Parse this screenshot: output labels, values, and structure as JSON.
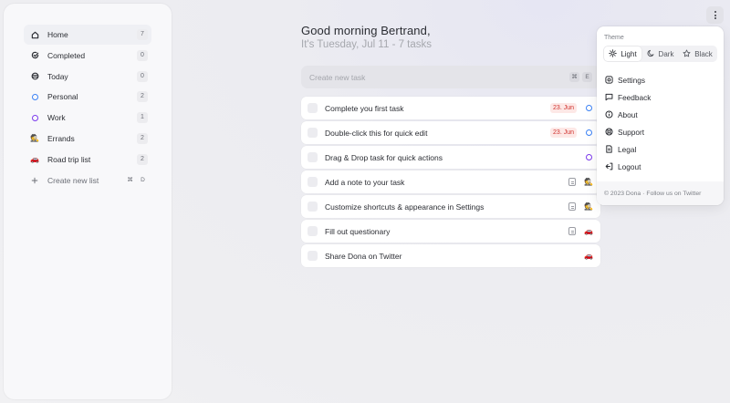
{
  "sidebar": {
    "items": [
      {
        "label": "Home",
        "count": "7",
        "icon": "home-icon"
      },
      {
        "label": "Completed",
        "count": "0",
        "icon": "check-circle-icon"
      },
      {
        "label": "Today",
        "count": "0",
        "icon": "calendar-stack-icon"
      },
      {
        "label": "Personal",
        "count": "2",
        "icon": "ring-icon",
        "color": "#3b82f6"
      },
      {
        "label": "Work",
        "count": "1",
        "icon": "ring-icon",
        "color": "#7c3aed"
      },
      {
        "label": "Errands",
        "count": "2",
        "icon": "person-emoji-icon"
      },
      {
        "label": "Road trip list",
        "count": "2",
        "icon": "car-emoji-icon"
      }
    ],
    "create": {
      "label": "Create new list",
      "kbd": [
        "⌘",
        "D"
      ]
    }
  },
  "main": {
    "greeting": "Good morning Bertrand,",
    "subline": "It's Tuesday, Jul 11 - 7 tasks",
    "create_placeholder": "Create new task",
    "create_kbd": [
      "⌘",
      "E"
    ],
    "tasks": [
      {
        "title": "Complete you first task",
        "date": "23. Jun",
        "list_icon": "ring-icon",
        "list_color": "#3b82f6"
      },
      {
        "title": "Double-click this for quick edit",
        "date": "23. Jun",
        "list_icon": "ring-icon",
        "list_color": "#3b82f6"
      },
      {
        "title": "Drag & Drop task for quick actions",
        "list_icon": "ring-icon",
        "list_color": "#7c3aed"
      },
      {
        "title": "Add a note to your task",
        "note": true,
        "list_icon": "person-emoji-icon"
      },
      {
        "title": "Customize shortcuts & appearance in Settings",
        "note": true,
        "list_icon": "person-emoji-icon"
      },
      {
        "title": "Fill out questionary",
        "note": true,
        "list_icon": "car-emoji-icon"
      },
      {
        "title": "Share Dona on Twitter",
        "list_icon": "car-emoji-icon"
      }
    ]
  },
  "menu": {
    "theme_label": "Theme",
    "themes": [
      {
        "label": "Light",
        "icon": "sun-icon",
        "active": true
      },
      {
        "label": "Dark",
        "icon": "moon-icon",
        "active": false
      },
      {
        "label": "Black",
        "icon": "star-icon",
        "active": false
      }
    ],
    "items": [
      {
        "label": "Settings",
        "icon": "settings-icon"
      },
      {
        "label": "Feedback",
        "icon": "feedback-icon"
      },
      {
        "label": "About",
        "icon": "info-icon"
      },
      {
        "label": "Support",
        "icon": "support-icon"
      },
      {
        "label": "Legal",
        "icon": "legal-icon"
      },
      {
        "label": "Logout",
        "icon": "logout-icon"
      }
    ],
    "footer": {
      "copyright": "© 2023 Dona",
      "separator": "·",
      "link": "Follow us on Twitter"
    }
  },
  "emoji": {
    "person": "🕵",
    "car": "🚗"
  }
}
